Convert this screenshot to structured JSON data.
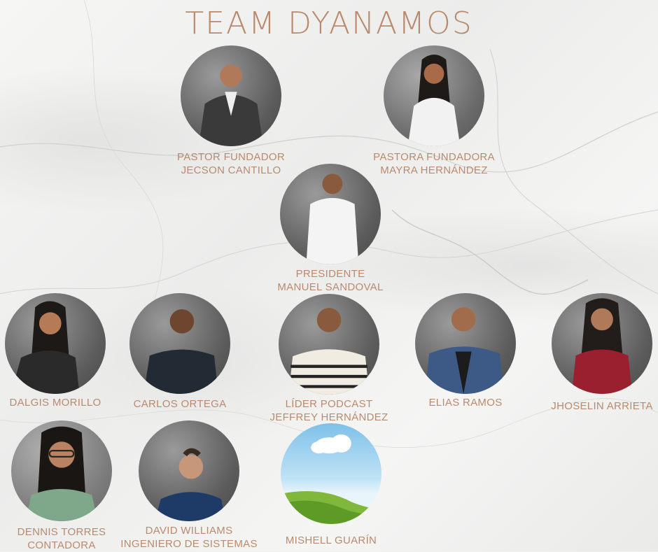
{
  "title": "TEAM DYANAMOS",
  "members": [
    {
      "role": "PASTOR FUNDADOR",
      "name": "JECSON CANTILLO"
    },
    {
      "role": "PASTORA FUNDADORA",
      "name": "MAYRA HERNÁNDEZ"
    },
    {
      "role": "PRESIDENTE",
      "name": "MANUEL SANDOVAL"
    },
    {
      "role": "",
      "name": "DALGIS MORILLO"
    },
    {
      "role": "",
      "name": "CARLOS ORTEGA"
    },
    {
      "role": "LÍDER PODCAST",
      "name": "JEFFREY HERNÁNDEZ"
    },
    {
      "role": "",
      "name": "ELIAS RAMOS"
    },
    {
      "role": "",
      "name": "JHOSELIN ARRIETA"
    },
    {
      "role": "DENNIS TORRES",
      "name": "CONTADORA"
    },
    {
      "role": "DAVID WILLIAMS",
      "name": "INGENIERO DE SISTEMAS"
    },
    {
      "role": "",
      "name": "MISHELL GUARÍN"
    }
  ],
  "colors": {
    "text": "#b98a6d",
    "background": "#f1f1f0"
  }
}
